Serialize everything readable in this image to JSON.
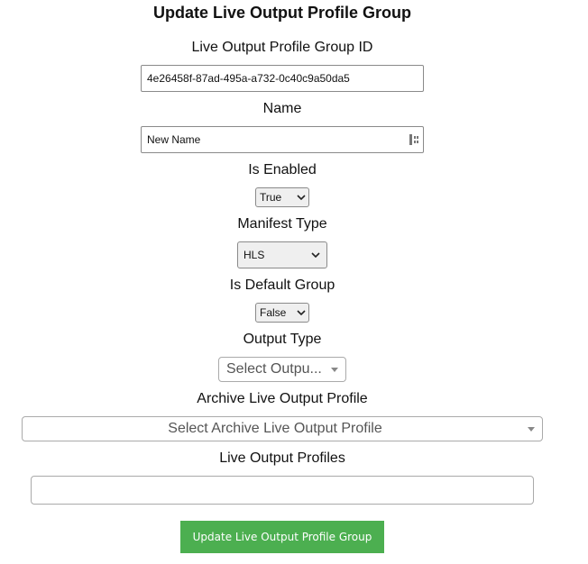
{
  "form": {
    "title": "Update Live Output Profile Group",
    "group_id": {
      "label": "Live Output Profile Group ID",
      "value": "4e26458f-87ad-495a-a732-0c40c9a50da5"
    },
    "name": {
      "label": "Name",
      "value": "New Name"
    },
    "is_enabled": {
      "label": "Is Enabled",
      "selected": "True"
    },
    "manifest_type": {
      "label": "Manifest Type",
      "selected": "HLS"
    },
    "is_default_group": {
      "label": "Is Default Group",
      "selected": "False"
    },
    "output_type": {
      "label": "Output Type",
      "placeholder": "Select Outpu..."
    },
    "archive_profile": {
      "label": "Archive Live Output Profile",
      "placeholder": "Select Archive Live Output Profile"
    },
    "live_output_profiles": {
      "label": "Live Output Profiles",
      "value": ""
    },
    "submit_label": "Update Live Output Profile Group"
  },
  "icons": {
    "select_chevron": "chevron-down-icon",
    "dropdown_arrow": "triangle-down-icon",
    "autofill": "password-manager-icon"
  },
  "colors": {
    "submit_background": "#4caf50",
    "submit_text": "#ffffff"
  }
}
